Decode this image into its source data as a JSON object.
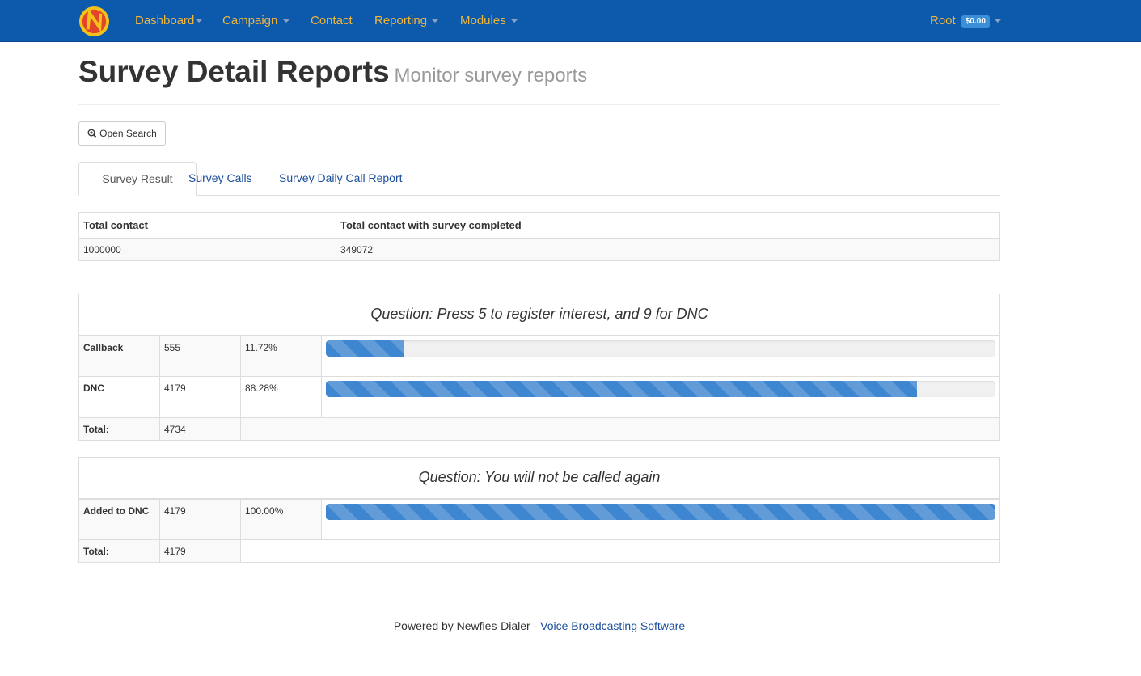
{
  "navbar": {
    "brand_color": "#0d5aad",
    "link_color": "#f2b63a",
    "items": [
      {
        "label": "Dashboard",
        "dropdown": true
      },
      {
        "label": "Campaign",
        "dropdown": true
      },
      {
        "label": "Contact",
        "dropdown": false
      },
      {
        "label": "Reporting",
        "dropdown": true
      },
      {
        "label": "Modules",
        "dropdown": true
      }
    ],
    "user": {
      "label": "Root",
      "balance": "$0.00"
    }
  },
  "header": {
    "title": "Survey Detail Reports",
    "subtitle": "Monitor survey reports"
  },
  "toolbar": {
    "search_label": "Open Search",
    "search_icon": "zoom-in-icon"
  },
  "tabs": [
    {
      "label": "Survey Result",
      "active": true
    },
    {
      "label": "Survey Calls",
      "active": false
    },
    {
      "label": "Survey Daily Call Report",
      "active": false
    }
  ],
  "summary": {
    "headers": [
      "Total contact",
      "Total contact with survey completed"
    ],
    "values": [
      "1000000",
      "349072"
    ]
  },
  "questions": [
    {
      "title": "Question: Press 5 to register interest, and 9 for DNC",
      "rows": [
        {
          "label": "Callback",
          "count": "555",
          "percent": "11.72%",
          "fraction": 0.1172
        },
        {
          "label": "DNC",
          "count": "4179",
          "percent": "88.28%",
          "fraction": 0.8828
        }
      ],
      "total_label": "Total:",
      "total": "4734"
    },
    {
      "title": "Question: You will not be called again",
      "rows": [
        {
          "label": "Added to DNC",
          "count": "4179",
          "percent": "100.00%",
          "fraction": 1.0
        }
      ],
      "total_label": "Total:",
      "total": "4179"
    }
  ],
  "footer": {
    "prefix": "Powered by Newfies-Dialer - ",
    "link": "Voice Broadcasting Software"
  }
}
